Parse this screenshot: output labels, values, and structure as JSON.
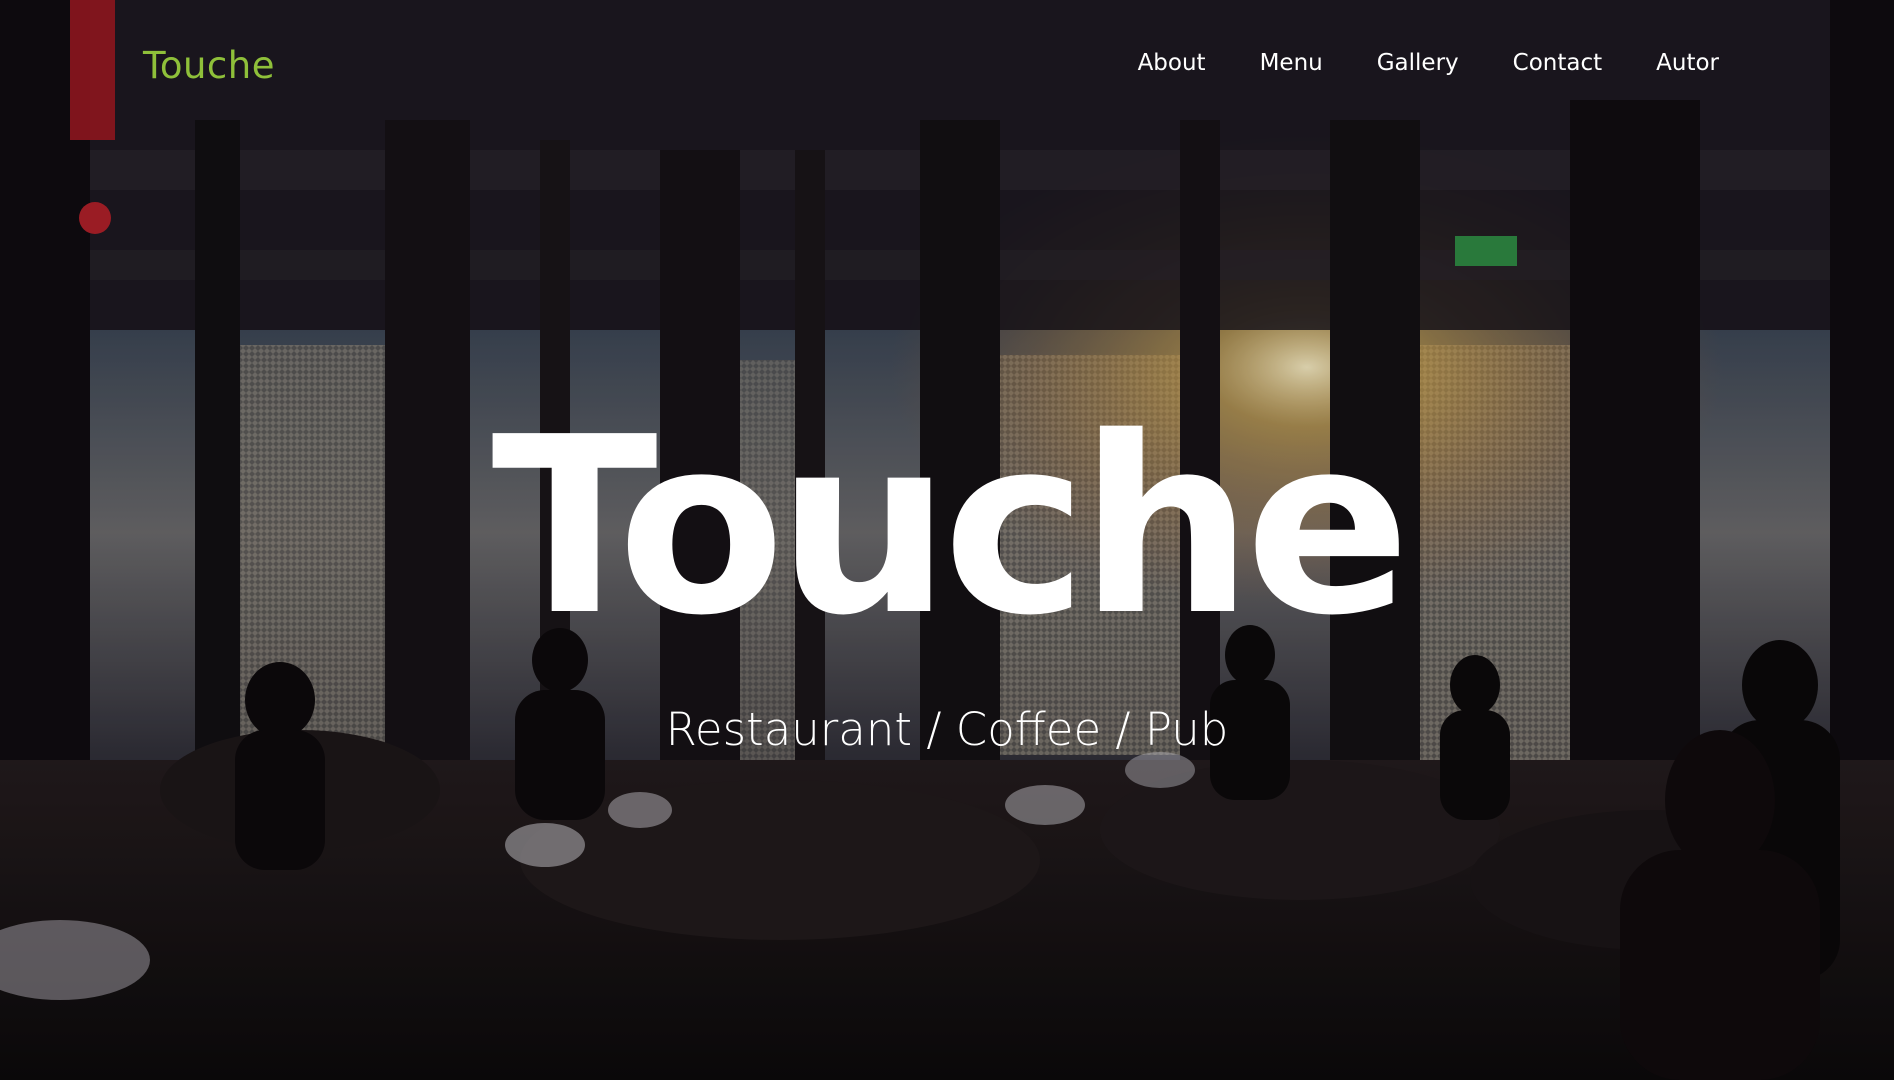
{
  "brand": {
    "logo_text": "Touche",
    "accent_color": "#8fc03a"
  },
  "nav": {
    "items": [
      {
        "label": "About"
      },
      {
        "label": "Menu"
      },
      {
        "label": "Gallery"
      },
      {
        "label": "Contact"
      },
      {
        "label": "Autor"
      }
    ]
  },
  "hero": {
    "title": "Touche",
    "subtitle": "Restaurant / Coffee / Pub",
    "background_image": "restaurant-interior-photo"
  }
}
